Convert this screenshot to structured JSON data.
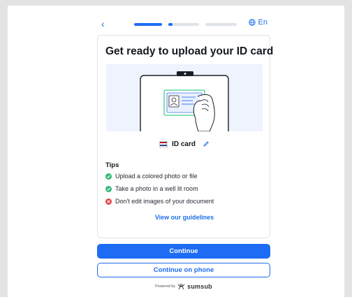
{
  "nav": {
    "back_glyph": "‹",
    "language": "En",
    "steps": [
      "done",
      "current",
      "pending"
    ]
  },
  "card": {
    "title": "Get ready to upload your ID card",
    "document": {
      "label": "ID card",
      "flag_colors": [
        "#ae1c28",
        "#ffffff",
        "#21468b"
      ]
    },
    "tips_heading": "Tips",
    "tips": [
      {
        "text": "Upload a colored photo or file",
        "status": "ok",
        "icon": "check-icon"
      },
      {
        "text": "Take a photo in a well lit room",
        "status": "ok",
        "icon": "check-icon"
      },
      {
        "text": "Don't edit images of your document",
        "status": "bad",
        "icon": "cross-icon"
      }
    ],
    "guidelines_link": "View our guidelines"
  },
  "actions": {
    "continue": "Continue",
    "continue_phone": "Continue on phone"
  },
  "footer": {
    "powered_by": "Powered by",
    "brand": "sumsub"
  },
  "colors": {
    "accent": "#1d6cf3",
    "ok": "#35b77a",
    "bad": "#e5484d",
    "illustration_bg": "#eef3fe"
  }
}
